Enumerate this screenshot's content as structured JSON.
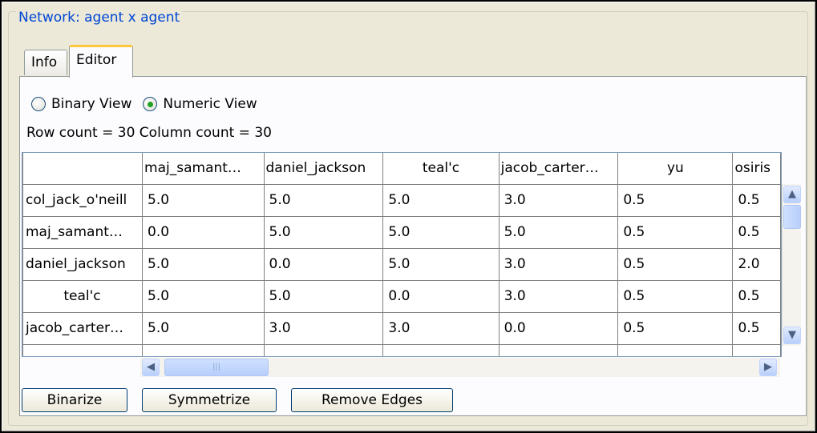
{
  "group_title": "Network: agent x agent",
  "tabs": [
    {
      "label": "Info",
      "active": false
    },
    {
      "label": "Editor",
      "active": true
    }
  ],
  "view_options": {
    "binary": {
      "label": "Binary View",
      "checked": false
    },
    "numeric": {
      "label": "Numeric View",
      "checked": true
    }
  },
  "count_label": "Row count = 30 Column count = 30",
  "table": {
    "columns": [
      "maj_samant…",
      "daniel_jackson",
      "teal'c",
      "jacob_carter…",
      "yu",
      "osiris"
    ],
    "rows": [
      {
        "label": "col_jack_o'neill",
        "values": [
          "5.0",
          "5.0",
          "5.0",
          "3.0",
          "0.5",
          "0.5"
        ]
      },
      {
        "label": "maj_samant…",
        "values": [
          "0.0",
          "5.0",
          "5.0",
          "5.0",
          "0.5",
          "0.5"
        ]
      },
      {
        "label": "daniel_jackson",
        "values": [
          "5.0",
          "0.0",
          "5.0",
          "3.0",
          "0.5",
          "2.0"
        ]
      },
      {
        "label": "teal'c",
        "values": [
          "5.0",
          "5.0",
          "0.0",
          "3.0",
          "0.5",
          "0.5"
        ]
      },
      {
        "label": "jacob_carter…",
        "values": [
          "5.0",
          "3.0",
          "3.0",
          "0.0",
          "0.5",
          "0.5"
        ]
      }
    ]
  },
  "buttons": {
    "binarize": "Binarize",
    "symmetrize": "Symmetrize",
    "remove_edges": "Remove Edges"
  },
  "icons": {
    "scroll_up": "chevron-up-icon",
    "scroll_down": "chevron-down-icon",
    "scroll_left": "chevron-left-icon",
    "scroll_right": "chevron-right-icon"
  },
  "colors": {
    "title": "#0046d5",
    "active_tab_accent": "#ffc83c",
    "radio_dot": "#21a121"
  }
}
